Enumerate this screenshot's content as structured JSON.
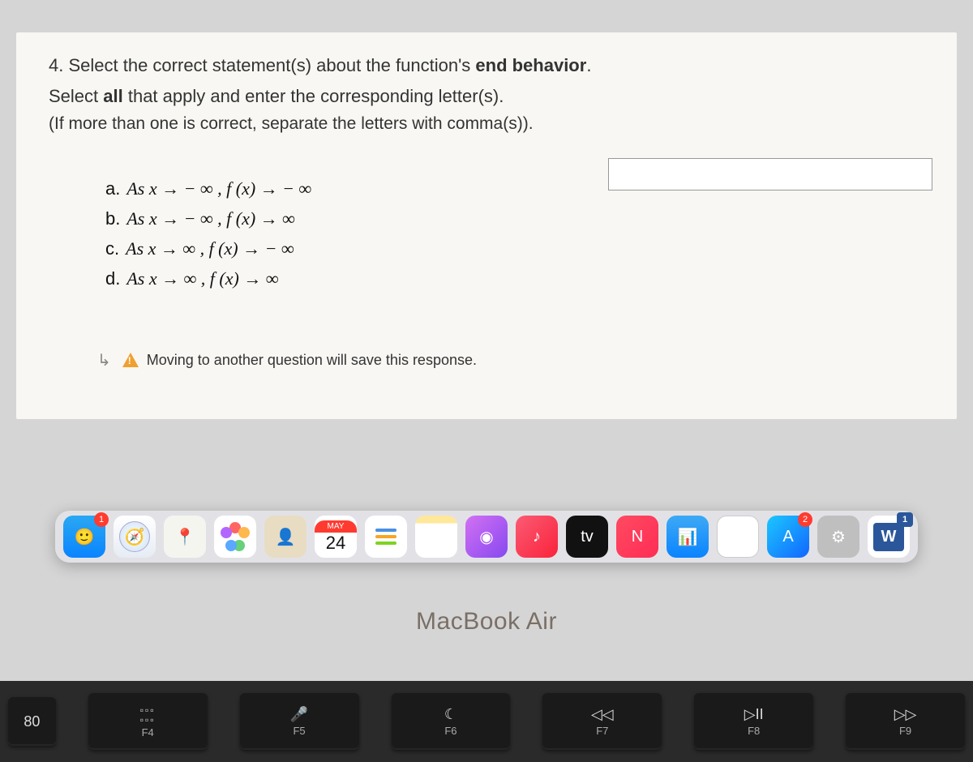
{
  "question": {
    "number": "4.",
    "prompt_pre": "Select the correct statement(s) about the function's ",
    "prompt_bold": "end behavior",
    "prompt_post": ".",
    "instruct_pre": "Select ",
    "instruct_bold": "all",
    "instruct_post": " that apply and enter the corresponding letter(s).",
    "note": "(If more than one is correct, separate the letters with comma(s))."
  },
  "options": {
    "a": {
      "label": "a.",
      "math": "As x → − ∞ , f (x) → − ∞"
    },
    "b": {
      "label": "b.",
      "math": "As x → − ∞ , f (x) → ∞"
    },
    "c": {
      "label": "c.",
      "math": "As x → ∞ , f (x) → − ∞"
    },
    "d": {
      "label": "d.",
      "math": "As x → ∞ , f (x) → ∞"
    }
  },
  "warning_text": "Moving to another question will save this response.",
  "calendar": {
    "month": "MAY",
    "day": "24"
  },
  "tv_label": "tv",
  "word_label": "W",
  "badges": {
    "finder": "1",
    "sys": "2",
    "word": "1"
  },
  "laptop": "MacBook Air",
  "keys": {
    "k0": {
      "sym": "80",
      "label": ""
    },
    "k1": {
      "sym": "⊞⊞",
      "label": "F4",
      "alt": "000\n000"
    },
    "k2": {
      "sym": "🎤",
      "label": "F5"
    },
    "k3": {
      "sym": "☾",
      "label": "F6"
    },
    "k4": {
      "sym": "◁◁",
      "label": "F7"
    },
    "k5": {
      "sym": "▷II",
      "label": "F8"
    },
    "k6": {
      "sym": "▷▷",
      "label": "F9"
    }
  }
}
